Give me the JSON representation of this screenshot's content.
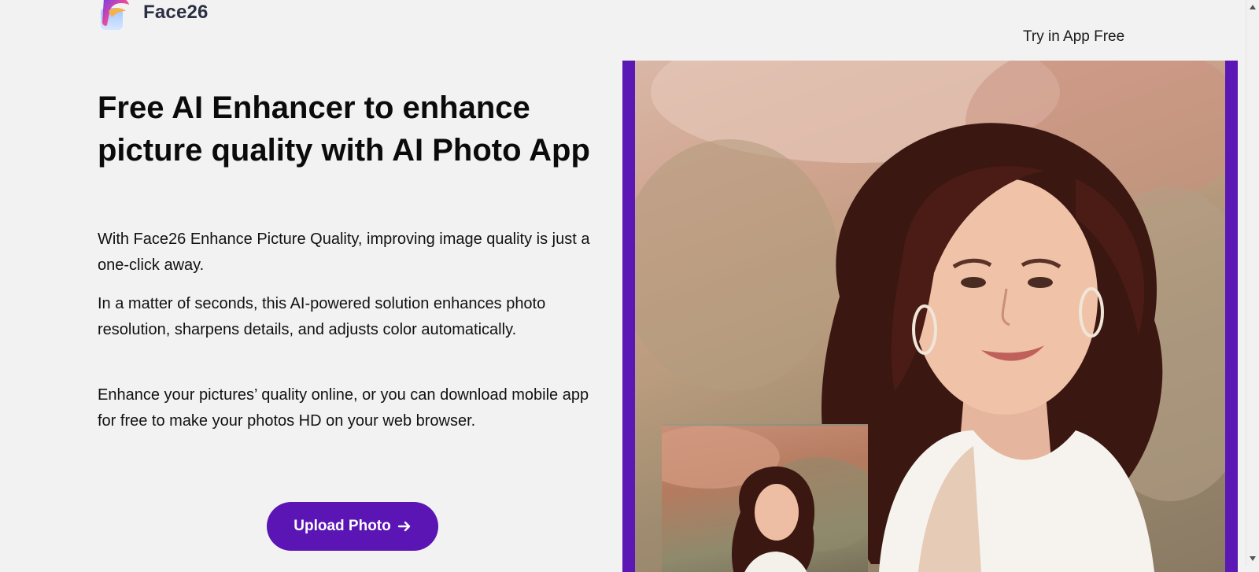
{
  "brand": {
    "name": "Face26"
  },
  "nav": {
    "try_link": "Try in App Free"
  },
  "hero": {
    "title": "Free AI Enhancer to enhance picture quality with AI Photo App",
    "paragraphs": [
      "With Face26 Enhance Picture Quality, improving image quality is just a one-click away.",
      "In a matter of seconds, this AI-powered solution enhances photo resolution, sharpens details, and adjusts color automatically.",
      "Enhance your pictures’ quality online, or you can download mobile app for free to make your photos HD on your web browser."
    ],
    "upload_button": "Upload Photo"
  },
  "colors": {
    "accent": "#5a15b4",
    "background": "#f2f2f2",
    "frame": "#5b18b5"
  },
  "icons": {
    "arrow": "arrow-right-icon",
    "logo": "face26-logo-icon"
  }
}
